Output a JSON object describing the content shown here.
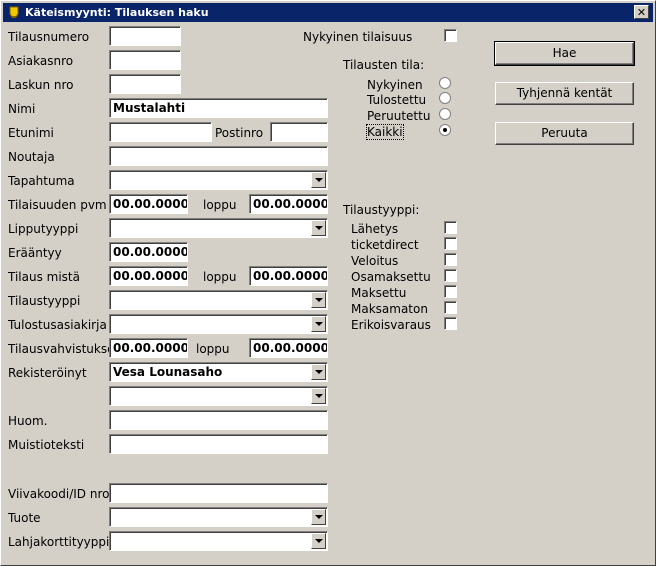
{
  "window": {
    "title": "Käteismyynti: Tilauksen haku",
    "close": "✕"
  },
  "fields": {
    "tilausnumero": {
      "label": "Tilausnumero",
      "value": ""
    },
    "asiakasnro": {
      "label": "Asiakasnro",
      "value": ""
    },
    "laskun_nro": {
      "label": "Laskun nro",
      "value": ""
    },
    "nimi": {
      "label": "Nimi",
      "value": "Mustalahti"
    },
    "etunimi": {
      "label": "Etunimi",
      "value": ""
    },
    "postinro": {
      "label": "Postinro",
      "value": ""
    },
    "noutaja": {
      "label": "Noutaja",
      "value": ""
    },
    "tapahtuma": {
      "label": "Tapahtuma",
      "value": ""
    },
    "tilaisuuden_pvm": {
      "label": "Tilaisuuden pvm",
      "from": "00.00.0000",
      "to_label": "loppu",
      "to": "00.00.0000"
    },
    "lipputyyppi": {
      "label": "Lipputyyppi",
      "value": ""
    },
    "eraantyy": {
      "label": "Erääntyy",
      "value": "00.00.0000"
    },
    "tilaus_mista": {
      "label": "Tilaus mistä",
      "from": "00.00.0000",
      "to_label": "loppu",
      "to": "00.00.0000"
    },
    "tilaustyyppi": {
      "label": "Tilaustyyppi",
      "value": ""
    },
    "tulostusasiakirja": {
      "label": "Tulostusasiakirja",
      "value": ""
    },
    "tilausvahvistukse": {
      "label": "Tilausvahvistukse",
      "from": "00.00.0000",
      "to_label": "loppu",
      "to": "00.00.0000"
    },
    "rekisteroinyt": {
      "label": "Rekisteröinyt",
      "value": "Vesa Lounasaho"
    },
    "rekisteroinyt2": {
      "value": ""
    },
    "huom": {
      "label": "Huom.",
      "value": ""
    },
    "muistioteksti": {
      "label": "Muistioteksti",
      "value": ""
    },
    "viivakoodi": {
      "label": "Viivakoodi/ID nro",
      "value": ""
    },
    "tuote": {
      "label": "Tuote",
      "value": ""
    },
    "lahjakorttityyppi": {
      "label": "Lahjakorttityyppi",
      "value": ""
    }
  },
  "nykyinen_tilaisuus": {
    "label": "Nykyinen tilaisuus",
    "checked": false
  },
  "tilausten_tila": {
    "heading": "Tilausten tila:",
    "options": [
      {
        "label": "Nykyinen",
        "selected": false
      },
      {
        "label": "Tulostettu",
        "selected": false
      },
      {
        "label": "Peruutettu",
        "selected": false
      },
      {
        "label": "Kaikki",
        "selected": true
      }
    ]
  },
  "tilaustyyppi_group": {
    "heading": "Tilaustyyppi:",
    "options": [
      {
        "label": "Lähetys",
        "checked": false
      },
      {
        "label": "ticketdirect",
        "checked": false
      },
      {
        "label": "Veloitus",
        "checked": false
      },
      {
        "label": "Osamaksettu",
        "checked": false
      },
      {
        "label": "Maksettu",
        "checked": false
      },
      {
        "label": "Maksamaton",
        "checked": false
      },
      {
        "label": "Erikoisvaraus",
        "checked": false
      }
    ]
  },
  "buttons": {
    "hae": "Hae",
    "tyhjenna": "Tyhjennä kentät",
    "peruuta": "Peruuta"
  },
  "colors": {
    "titlebar": "#0a246a",
    "face": "#d4d0c8"
  }
}
